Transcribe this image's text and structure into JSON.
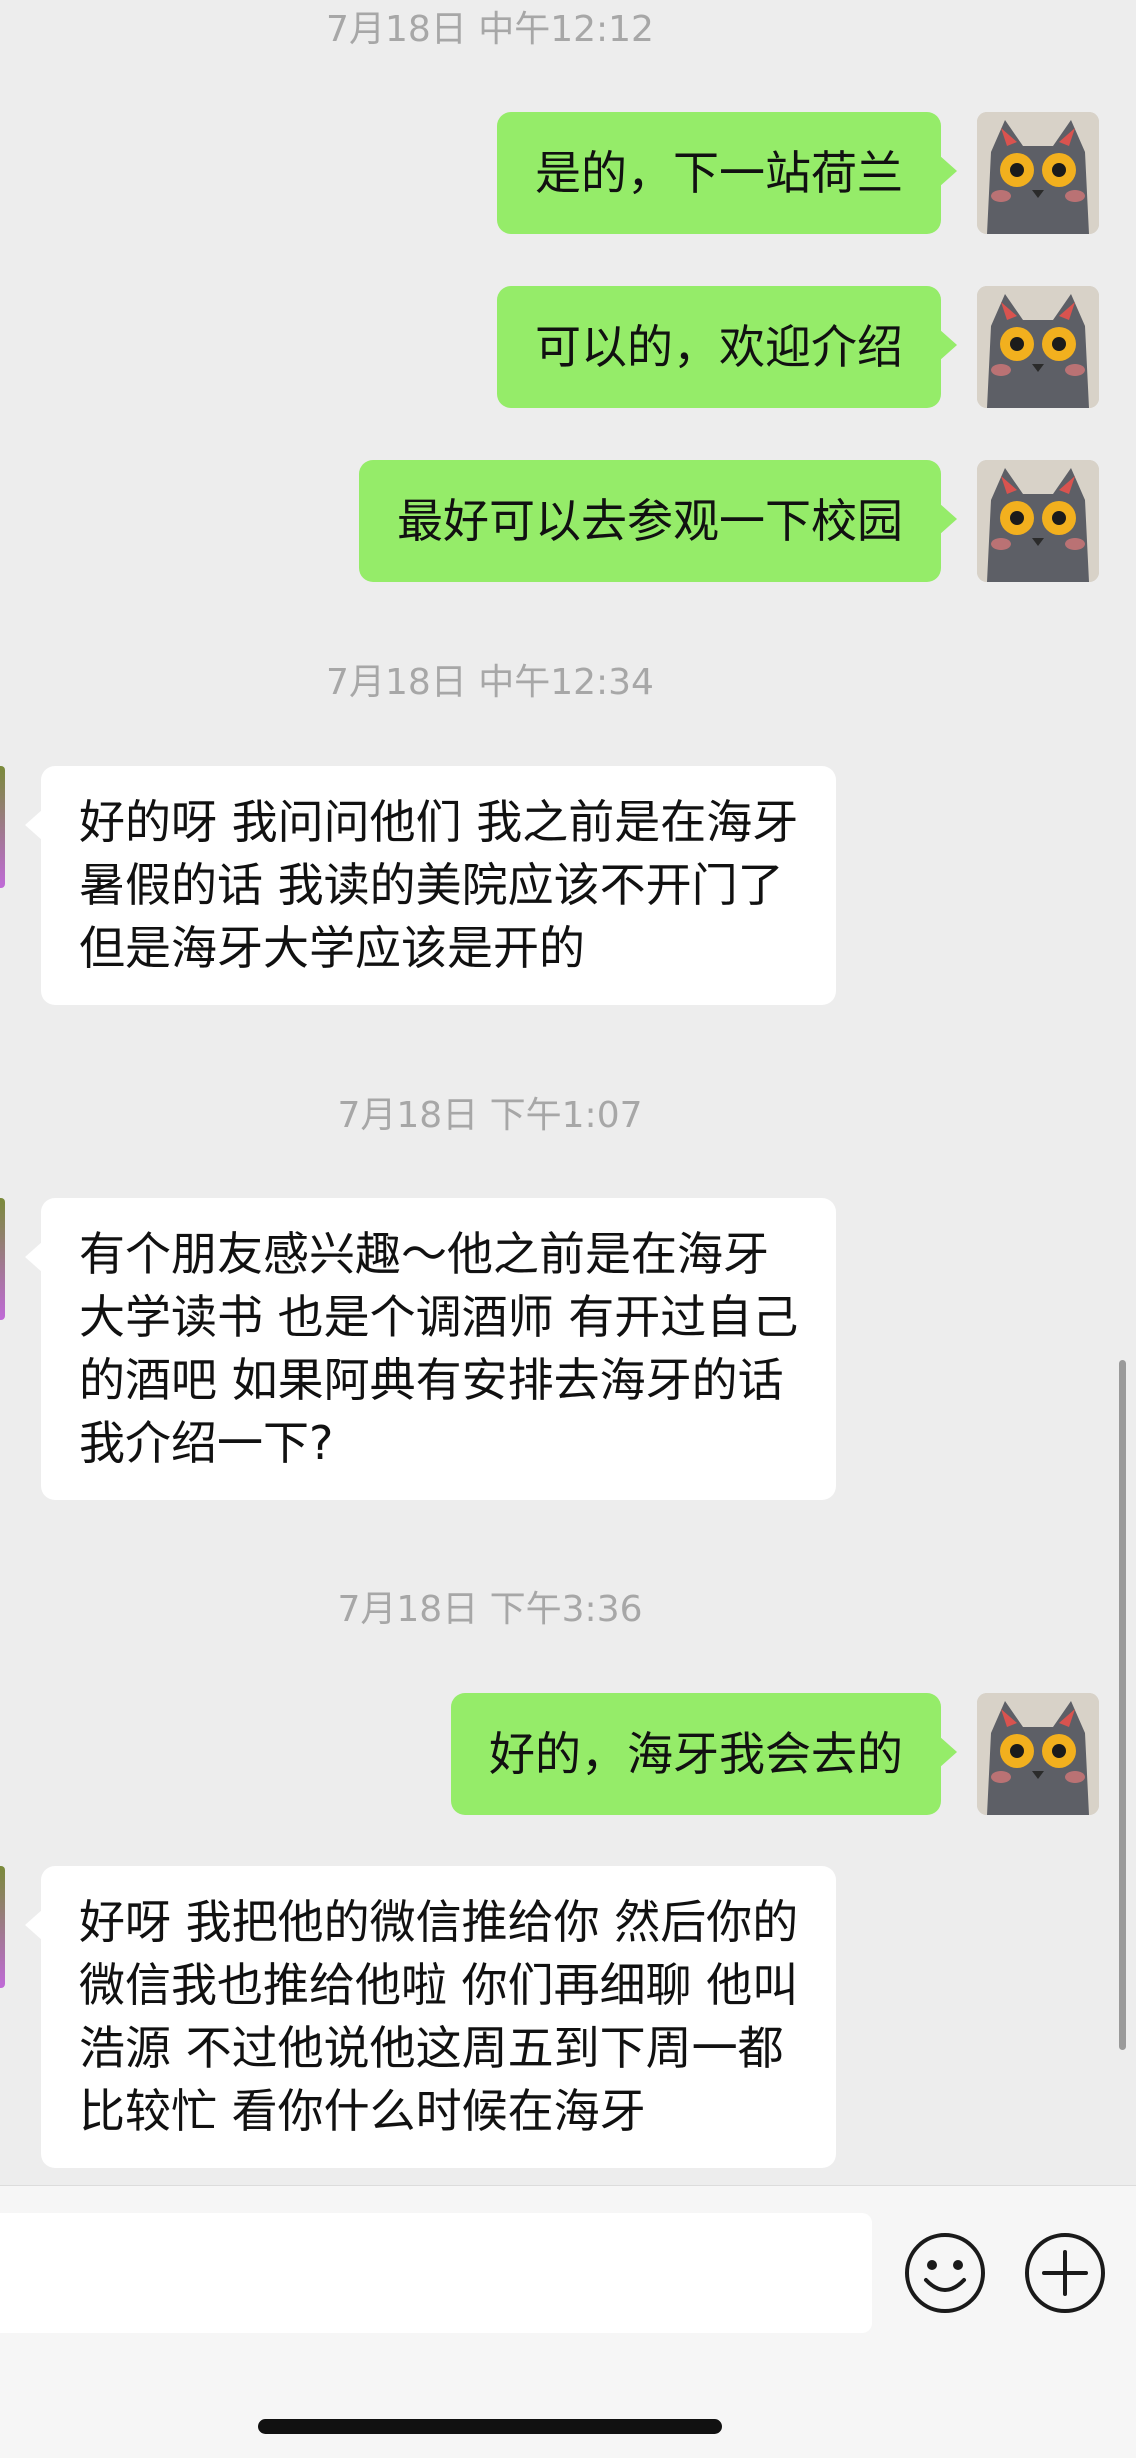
{
  "conversation": [
    {
      "type": "timestamp",
      "text": "7月18日 中午12:12"
    },
    {
      "type": "outgoing",
      "text": "是的，下一站荷兰"
    },
    {
      "type": "outgoing",
      "text": "可以的，欢迎介绍"
    },
    {
      "type": "outgoing",
      "text": "最好可以去参观一下校园"
    },
    {
      "type": "timestamp",
      "text": "7月18日 中午12:34"
    },
    {
      "type": "incoming",
      "text": "好的呀 我问问他们 我之前是在海牙\n暑假的话 我读的美院应该不开门了\n但是海牙大学应该是开的"
    },
    {
      "type": "timestamp",
      "text": "7月18日 下午1:07"
    },
    {
      "type": "incoming",
      "text": "有个朋友感兴趣～他之前是在海牙\n大学读书 也是个调酒师 有开过自己\n的酒吧 如果阿典有安排去海牙的话\n我介绍一下?"
    },
    {
      "type": "timestamp",
      "text": "7月18日 下午3:36"
    },
    {
      "type": "outgoing",
      "text": "好的，海牙我会去的"
    },
    {
      "type": "incoming",
      "text": "好呀 我把他的微信推给你 然后你的\n微信我也推给他啦 你们再细聊 他叫\n浩源  不过他说他这周五到下周一都\n比较忙 看你什么时候在海牙"
    }
  ],
  "input_bar": {
    "message_value": "",
    "emoji_icon": "emoji-smile-icon",
    "more_icon": "plus-circle-icon"
  },
  "colors": {
    "background": "#ededed",
    "outgoing_bubble": "#95ec69",
    "incoming_bubble": "#ffffff",
    "timestamp_text": "#a7a7a7"
  }
}
